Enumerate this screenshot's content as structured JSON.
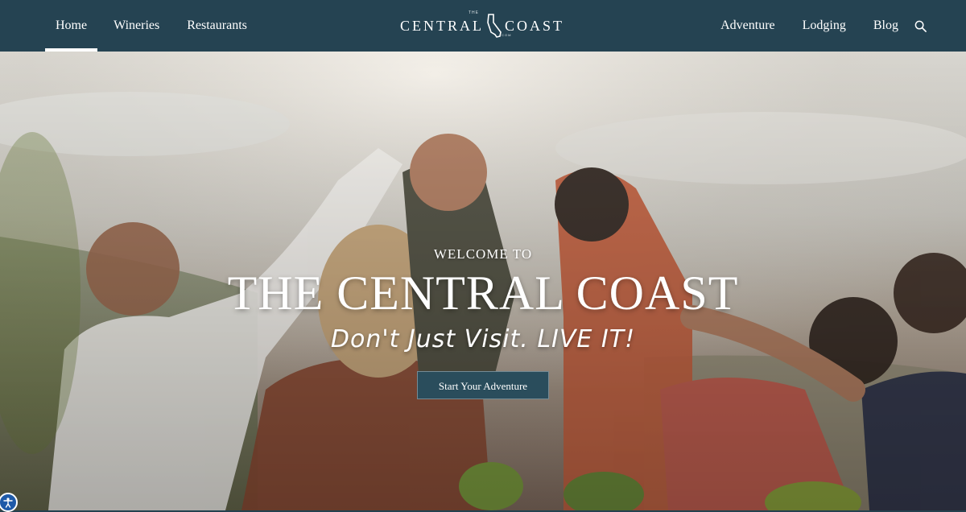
{
  "nav": {
    "left": [
      {
        "label": "Home",
        "active": true
      },
      {
        "label": "Wineries"
      },
      {
        "label": "Restaurants"
      }
    ],
    "right": [
      {
        "label": "Adventure"
      },
      {
        "label": "Lodging"
      },
      {
        "label": "Blog"
      }
    ],
    "search_icon": "search-icon"
  },
  "logo": {
    "top": "THE",
    "word_left": "CENTRAL",
    "word_right": "COAST",
    "bottom": ".COM"
  },
  "hero": {
    "welcome": "WELCOME TO",
    "headline": "THE CENTRAL COAST",
    "tagline": "Don't Just Visit. LIVE IT!",
    "cta": "Start Your Adventure"
  },
  "accessibility_icon": "accessibility-icon",
  "colors": {
    "nav_bg": "#254352",
    "cta_bg": "#2a4d5c",
    "accent": "#ffffff"
  }
}
